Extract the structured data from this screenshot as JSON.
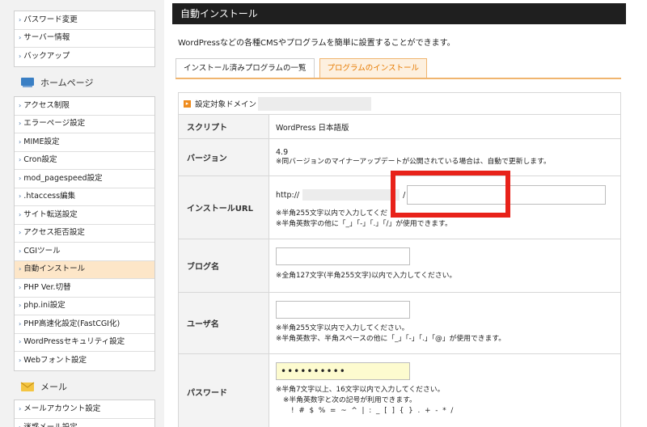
{
  "sidebar": {
    "group_top": [
      {
        "label": "パスワード変更"
      },
      {
        "label": "サーバー情報"
      },
      {
        "label": "バックアップ"
      }
    ],
    "homepage_heading": "ホームページ",
    "homepage_items": [
      {
        "label": "アクセス制限"
      },
      {
        "label": "エラーページ設定"
      },
      {
        "label": "MIME設定"
      },
      {
        "label": "Cron設定"
      },
      {
        "label": "mod_pagespeed設定"
      },
      {
        "label": ".htaccess編集"
      },
      {
        "label": "サイト転送設定"
      },
      {
        "label": "アクセス拒否設定"
      },
      {
        "label": "CGIツール"
      },
      {
        "label": "自動インストール"
      },
      {
        "label": "PHP Ver.切替"
      },
      {
        "label": "php.ini設定"
      },
      {
        "label": "PHP高速化設定(FastCGI化)"
      },
      {
        "label": "WordPressセキュリティ設定"
      },
      {
        "label": "Webフォント設定"
      }
    ],
    "mail_heading": "メール",
    "mail_items": [
      {
        "label": "メールアカウント設定"
      },
      {
        "label": "迷惑メール設定"
      }
    ],
    "active_item": "自動インストール",
    "arrow_glyph": "›"
  },
  "main": {
    "title": "自動インストール",
    "lead": "WordPressなどの各種CMSやプログラムを簡単に設置することができます。",
    "tabs": [
      {
        "label": "インストール済みプログラムの一覧"
      },
      {
        "label": "プログラムのインストール"
      }
    ],
    "domain_label": "設定対象ドメイン",
    "rows": {
      "script_label": "スクリプト",
      "script_value": "WordPress 日本語版",
      "version_label": "バージョン",
      "version_value": "4.9",
      "version_note": "※同バージョンのマイナーアップデートが公開されている場合は、自動で更新します。",
      "url_label": "インストールURL",
      "url_prefix": "http://",
      "url_slash": "/",
      "url_note1": "※半角255文字以内で入力してくだ",
      "url_note2": "※半角英数字の他に「_」「-」「.」「/」が使用できます。",
      "blog_label": "ブログ名",
      "blog_note": "※全角127文字(半角255文字)以内で入力してください。",
      "user_label": "ユーザ名",
      "user_note1": "※半角255文字以内で入力してください。",
      "user_note2": "※半角英数字、半角スペースの他に「_」「-」「.」「@」が使用できます。",
      "password_label": "パスワード",
      "password_value": "••••••••••",
      "pw_note1": "※半角7文字以上、16文字以内で入力してください。",
      "pw_note2": "※半角英数字と次の記号が利用できます。",
      "pw_note3": "! # $ % = ~ ^ | : _ [ ] { } . + - * /"
    }
  },
  "colors": {
    "accent": "#e67a00",
    "highlight": "#e8221a",
    "active_bg": "#fde6c8"
  }
}
